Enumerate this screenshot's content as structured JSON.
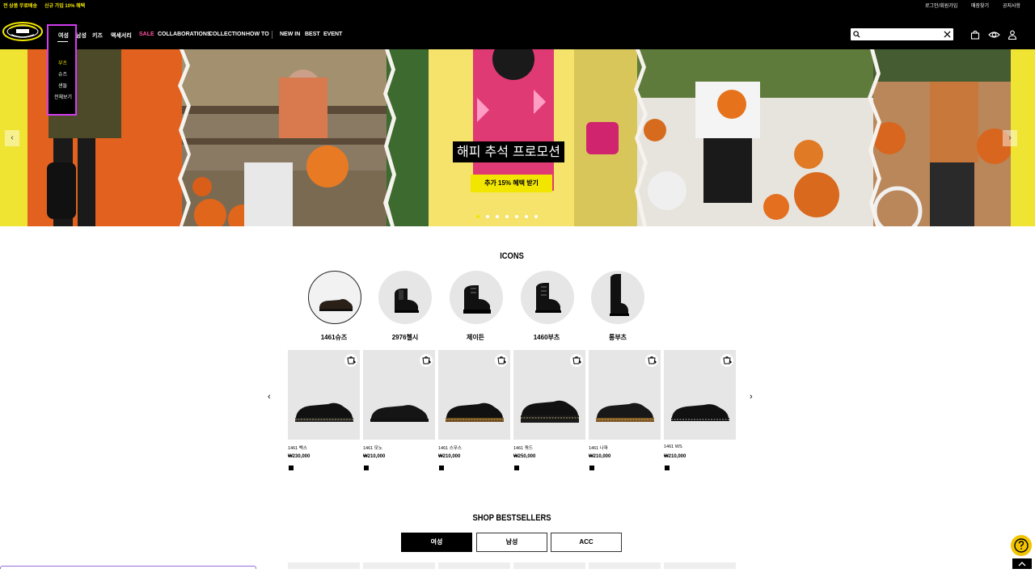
{
  "topbar": {
    "promo_free_shipping": "전 상품 무료배송",
    "promo_signup": "신규 가입 10% 혜택",
    "login_link": "로그인/회원가입",
    "stores_link": "매장찾기",
    "notice_link": "공지사항"
  },
  "nav": {
    "women": "여성",
    "men": "남성",
    "kids": "키즈",
    "accessories": "액세서리",
    "sale": "SALE",
    "collaborations": "COLLABORATIONS",
    "collection": "COLLECTION",
    "how_to": "HOW TO",
    "new_in": "NEW IN",
    "best": "BEST",
    "event": "EVENT"
  },
  "dropdown": {
    "title": "여성",
    "items": [
      "부츠",
      "슈즈",
      "샌들",
      "전체보기"
    ]
  },
  "search": {
    "value": "",
    "placeholder": ""
  },
  "hero": {
    "title": "해피 추석 프로모션",
    "button": "추가 15% 혜택 받기",
    "slide_count": 7,
    "active_slide": 1
  },
  "icons_section": {
    "title": "ICONS",
    "items": [
      {
        "label": "1461슈즈",
        "selected": true
      },
      {
        "label": "2976첼시",
        "selected": false
      },
      {
        "label": "제이든",
        "selected": false
      },
      {
        "label": "1460부츠",
        "selected": false
      },
      {
        "label": "롱부츠",
        "selected": false
      }
    ]
  },
  "products": [
    {
      "name": "1461 벡스",
      "price": "₩230,000",
      "swatch": "#000000"
    },
    {
      "name": "1461 모노",
      "price": "₩210,000",
      "swatch": "#000000"
    },
    {
      "name": "1461 스무스",
      "price": "₩210,000",
      "swatch": "#000000"
    },
    {
      "name": "1461 쿼드",
      "price": "₩250,000",
      "swatch": "#000000"
    },
    {
      "name": "1461 나파",
      "price": "₩210,000",
      "swatch": "#000000"
    },
    {
      "name": "1461 WS",
      "price": "₩210,000",
      "swatch": "#000000"
    }
  ],
  "bestsellers": {
    "title": "SHOP BESTSELLERS",
    "tabs": [
      "여성",
      "남성",
      "ACC"
    ],
    "active_tab": 0
  },
  "colors": {
    "accent_yellow": "#f2e600",
    "sale_pink": "#ff4fa3",
    "highlight_magenta": "#d43cf0",
    "background": "#ffffff",
    "header": "#000000"
  }
}
